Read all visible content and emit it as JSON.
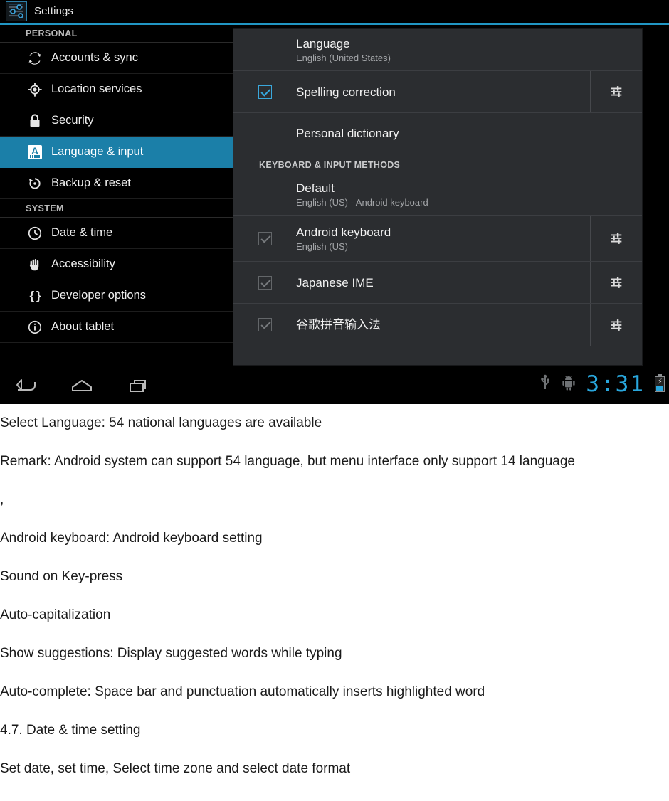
{
  "screenshot": {
    "app_title": "Settings",
    "app_icon": "sliders-icon",
    "accent_color": "#1b7fa8",
    "clock_color": "#29a7dd",
    "sidebar": {
      "groups": [
        {
          "label": "PERSONAL",
          "items": [
            {
              "label": "Accounts & sync",
              "icon": "sync-icon",
              "selected": false
            },
            {
              "label": "Location services",
              "icon": "location-crosshair-icon",
              "selected": false
            },
            {
              "label": "Security",
              "icon": "lock-icon",
              "selected": false
            },
            {
              "label": "Language & input",
              "icon": "language-a-icon",
              "selected": true
            },
            {
              "label": "Backup & reset",
              "icon": "restore-icon",
              "selected": false
            }
          ]
        },
        {
          "label": "SYSTEM",
          "items": [
            {
              "label": "Date & time",
              "icon": "clock-icon",
              "selected": false
            },
            {
              "label": "Accessibility",
              "icon": "hand-icon",
              "selected": false
            },
            {
              "label": "Developer options",
              "icon": "braces-icon",
              "selected": false
            },
            {
              "label": "About tablet",
              "icon": "info-circle-icon",
              "selected": false
            }
          ]
        }
      ]
    },
    "panel": {
      "rows": [
        {
          "title": "Language",
          "subtitle": "English (United States)",
          "checkbox": null,
          "gear": false
        },
        {
          "title": "Spelling correction",
          "subtitle": "",
          "checkbox": "checked",
          "gear": true
        },
        {
          "title": "Personal dictionary",
          "subtitle": "",
          "checkbox": null,
          "gear": false
        }
      ],
      "section_header": "KEYBOARD & INPUT METHODS",
      "method_rows": [
        {
          "title": "Default",
          "subtitle": "English (US) - Android keyboard",
          "checkbox": null,
          "gear": false
        },
        {
          "title": "Android keyboard",
          "subtitle": "English (US)",
          "checkbox": "checked-dim",
          "gear": true
        },
        {
          "title": "Japanese IME",
          "subtitle": "",
          "checkbox": "checked-dim",
          "gear": true
        },
        {
          "title": "谷歌拼音输入法",
          "subtitle": "",
          "checkbox": "checked-dim",
          "gear": true
        }
      ]
    },
    "system_bar": {
      "back": "back-icon",
      "home": "home-icon",
      "recents": "recents-icon",
      "usb": "usb-icon",
      "adb": "android-robot-icon",
      "clock": "3:31",
      "battery": "battery-charging-icon"
    }
  },
  "document": {
    "paragraphs": [
      "Select Language: 54  national languages are available",
      "Remark: Android system can support 54  language, but menu interface only support 14 language",
      ",",
      "Android keyboard: Android keyboard setting",
      "Sound on Key-press",
      "Auto-capitalization",
      "Show suggestions: Display suggested words while typing",
      "Auto-complete: Space bar and punctuation automatically inserts highlighted word",
      "4.7. Date & time setting",
      "Set date, set time, Select time zone and select date format"
    ]
  }
}
